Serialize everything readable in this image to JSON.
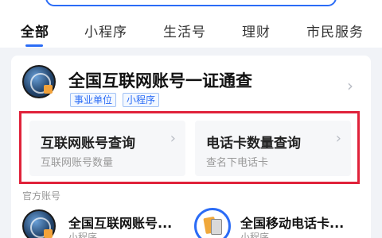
{
  "tabs": [
    "全部",
    "小程序",
    "生活号",
    "理财",
    "市民服务"
  ],
  "card": {
    "title": "全国互联网账号一证通查",
    "tags": [
      "事业单位",
      "小程序"
    ]
  },
  "services": [
    {
      "title": "互联网账号查询",
      "subtitle": "互联网账号数量"
    },
    {
      "title": "电话卡数量查询",
      "subtitle": "查名下电话卡"
    }
  ],
  "section_label": "官方账号",
  "accounts": [
    {
      "title": "全国互联网账号...",
      "subtitle": "小程序"
    },
    {
      "title": "全国移动电话卡...",
      "subtitle": "小程序"
    }
  ],
  "colors": {
    "accent": "#2b6cf6",
    "highlight": "#e0223a"
  },
  "icons": [
    "search-box",
    "globe-lock-logo",
    "chevron-right-icon",
    "phone-cards-search-logo"
  ]
}
